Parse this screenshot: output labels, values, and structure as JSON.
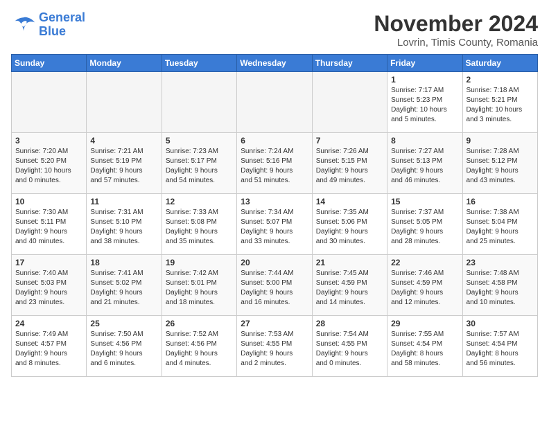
{
  "header": {
    "logo_line1": "General",
    "logo_line2": "Blue",
    "month": "November 2024",
    "location": "Lovrin, Timis County, Romania"
  },
  "weekdays": [
    "Sunday",
    "Monday",
    "Tuesday",
    "Wednesday",
    "Thursday",
    "Friday",
    "Saturday"
  ],
  "weeks": [
    [
      {
        "day": "",
        "info": ""
      },
      {
        "day": "",
        "info": ""
      },
      {
        "day": "",
        "info": ""
      },
      {
        "day": "",
        "info": ""
      },
      {
        "day": "",
        "info": ""
      },
      {
        "day": "1",
        "info": "Sunrise: 7:17 AM\nSunset: 5:23 PM\nDaylight: 10 hours\nand 5 minutes."
      },
      {
        "day": "2",
        "info": "Sunrise: 7:18 AM\nSunset: 5:21 PM\nDaylight: 10 hours\nand 3 minutes."
      }
    ],
    [
      {
        "day": "3",
        "info": "Sunrise: 7:20 AM\nSunset: 5:20 PM\nDaylight: 10 hours\nand 0 minutes."
      },
      {
        "day": "4",
        "info": "Sunrise: 7:21 AM\nSunset: 5:19 PM\nDaylight: 9 hours\nand 57 minutes."
      },
      {
        "day": "5",
        "info": "Sunrise: 7:23 AM\nSunset: 5:17 PM\nDaylight: 9 hours\nand 54 minutes."
      },
      {
        "day": "6",
        "info": "Sunrise: 7:24 AM\nSunset: 5:16 PM\nDaylight: 9 hours\nand 51 minutes."
      },
      {
        "day": "7",
        "info": "Sunrise: 7:26 AM\nSunset: 5:15 PM\nDaylight: 9 hours\nand 49 minutes."
      },
      {
        "day": "8",
        "info": "Sunrise: 7:27 AM\nSunset: 5:13 PM\nDaylight: 9 hours\nand 46 minutes."
      },
      {
        "day": "9",
        "info": "Sunrise: 7:28 AM\nSunset: 5:12 PM\nDaylight: 9 hours\nand 43 minutes."
      }
    ],
    [
      {
        "day": "10",
        "info": "Sunrise: 7:30 AM\nSunset: 5:11 PM\nDaylight: 9 hours\nand 40 minutes."
      },
      {
        "day": "11",
        "info": "Sunrise: 7:31 AM\nSunset: 5:10 PM\nDaylight: 9 hours\nand 38 minutes."
      },
      {
        "day": "12",
        "info": "Sunrise: 7:33 AM\nSunset: 5:08 PM\nDaylight: 9 hours\nand 35 minutes."
      },
      {
        "day": "13",
        "info": "Sunrise: 7:34 AM\nSunset: 5:07 PM\nDaylight: 9 hours\nand 33 minutes."
      },
      {
        "day": "14",
        "info": "Sunrise: 7:35 AM\nSunset: 5:06 PM\nDaylight: 9 hours\nand 30 minutes."
      },
      {
        "day": "15",
        "info": "Sunrise: 7:37 AM\nSunset: 5:05 PM\nDaylight: 9 hours\nand 28 minutes."
      },
      {
        "day": "16",
        "info": "Sunrise: 7:38 AM\nSunset: 5:04 PM\nDaylight: 9 hours\nand 25 minutes."
      }
    ],
    [
      {
        "day": "17",
        "info": "Sunrise: 7:40 AM\nSunset: 5:03 PM\nDaylight: 9 hours\nand 23 minutes."
      },
      {
        "day": "18",
        "info": "Sunrise: 7:41 AM\nSunset: 5:02 PM\nDaylight: 9 hours\nand 21 minutes."
      },
      {
        "day": "19",
        "info": "Sunrise: 7:42 AM\nSunset: 5:01 PM\nDaylight: 9 hours\nand 18 minutes."
      },
      {
        "day": "20",
        "info": "Sunrise: 7:44 AM\nSunset: 5:00 PM\nDaylight: 9 hours\nand 16 minutes."
      },
      {
        "day": "21",
        "info": "Sunrise: 7:45 AM\nSunset: 4:59 PM\nDaylight: 9 hours\nand 14 minutes."
      },
      {
        "day": "22",
        "info": "Sunrise: 7:46 AM\nSunset: 4:59 PM\nDaylight: 9 hours\nand 12 minutes."
      },
      {
        "day": "23",
        "info": "Sunrise: 7:48 AM\nSunset: 4:58 PM\nDaylight: 9 hours\nand 10 minutes."
      }
    ],
    [
      {
        "day": "24",
        "info": "Sunrise: 7:49 AM\nSunset: 4:57 PM\nDaylight: 9 hours\nand 8 minutes."
      },
      {
        "day": "25",
        "info": "Sunrise: 7:50 AM\nSunset: 4:56 PM\nDaylight: 9 hours\nand 6 minutes."
      },
      {
        "day": "26",
        "info": "Sunrise: 7:52 AM\nSunset: 4:56 PM\nDaylight: 9 hours\nand 4 minutes."
      },
      {
        "day": "27",
        "info": "Sunrise: 7:53 AM\nSunset: 4:55 PM\nDaylight: 9 hours\nand 2 minutes."
      },
      {
        "day": "28",
        "info": "Sunrise: 7:54 AM\nSunset: 4:55 PM\nDaylight: 9 hours\nand 0 minutes."
      },
      {
        "day": "29",
        "info": "Sunrise: 7:55 AM\nSunset: 4:54 PM\nDaylight: 8 hours\nand 58 minutes."
      },
      {
        "day": "30",
        "info": "Sunrise: 7:57 AM\nSunset: 4:54 PM\nDaylight: 8 hours\nand 56 minutes."
      }
    ]
  ]
}
